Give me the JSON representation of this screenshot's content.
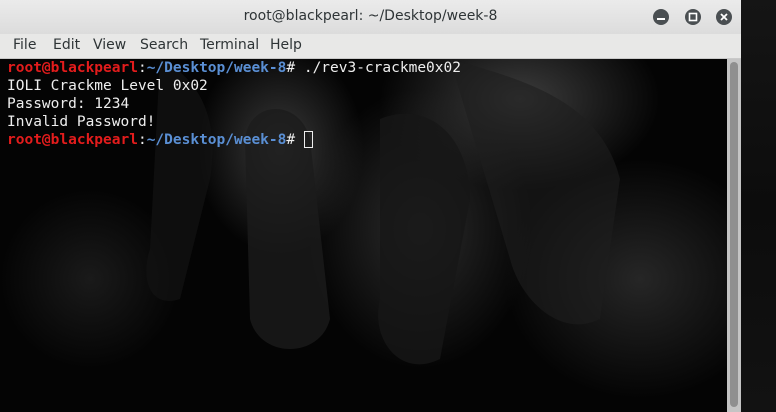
{
  "window": {
    "title": "root@blackpearl: ~/Desktop/week-8",
    "buttons": [
      "minimize-icon",
      "maximize-icon",
      "close-icon"
    ]
  },
  "menu": {
    "items": [
      "File",
      "Edit",
      "View",
      "Search",
      "Terminal",
      "Help"
    ]
  },
  "terminal": {
    "prompt": {
      "user_host": "root@blackpearl",
      "separator": ":",
      "path": "~/Desktop/week-8",
      "symbol": "# "
    },
    "command": "./rev3-crackme0x02",
    "output": [
      "IOLI Crackme Level 0x02",
      "Password: 1234",
      "Invalid Password!"
    ],
    "colors": {
      "user_host": "#e31c1c",
      "path": "#5a8fd4",
      "text": "#eeeeee",
      "background": "#040404"
    }
  }
}
